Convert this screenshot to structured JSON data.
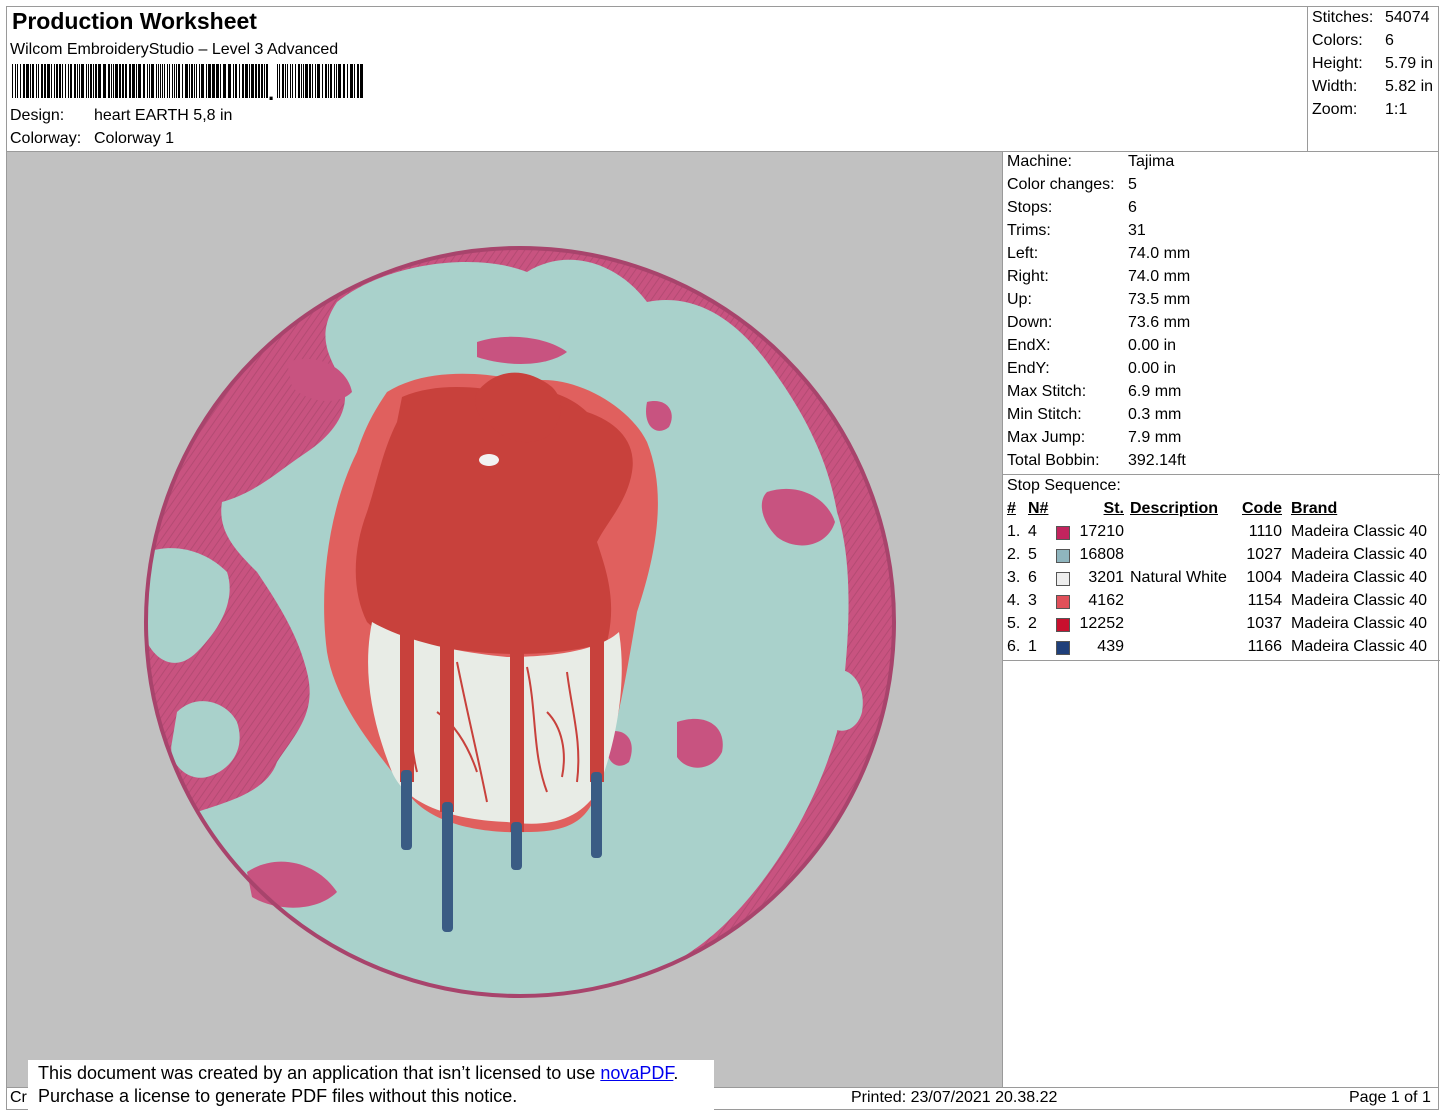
{
  "header": {
    "title": "Production Worksheet",
    "software": "Wilcom EmbroideryStudio – Level 3 Advanced",
    "design_label": "Design:",
    "design_value": "heart EARTH 5,8 in",
    "colorway_label": "Colorway:",
    "colorway_value": "Colorway 1"
  },
  "stats": [
    {
      "label": "Stitches:",
      "value": "54074"
    },
    {
      "label": "Colors:",
      "value": "6"
    },
    {
      "label": "Height:",
      "value": "5.79 in"
    },
    {
      "label": "Width:",
      "value": "5.82 in"
    },
    {
      "label": "Zoom:",
      "value": "1:1"
    }
  ],
  "machine_info": [
    {
      "label": "Machine:",
      "value": "Tajima"
    },
    {
      "label": "Color changes:",
      "value": "5"
    },
    {
      "label": "Stops:",
      "value": "6"
    },
    {
      "label": "Trims:",
      "value": "31"
    },
    {
      "label": "Left:",
      "value": "74.0 mm"
    },
    {
      "label": "Right:",
      "value": "74.0 mm"
    },
    {
      "label": "Up:",
      "value": "73.5 mm"
    },
    {
      "label": "Down:",
      "value": "73.6 mm"
    },
    {
      "label": "EndX:",
      "value": "0.00 in"
    },
    {
      "label": "EndY:",
      "value": "0.00 in"
    },
    {
      "label": "Max Stitch:",
      "value": "6.9 mm"
    },
    {
      "label": "Min Stitch:",
      "value": "0.3 mm"
    },
    {
      "label": "Max Jump:",
      "value": "7.9 mm"
    },
    {
      "label": "Total Bobbin:",
      "value": "392.14ft"
    }
  ],
  "stop_sequence": {
    "title": "Stop Sequence:",
    "headers": {
      "idx": "#",
      "n": "N#",
      "st": "St.",
      "description": "Description",
      "code": "Code",
      "brand": "Brand"
    },
    "rows": [
      {
        "idx": "1.",
        "n": "4",
        "color": "#c2245e",
        "st": "17210",
        "description": "",
        "code": "1110",
        "brand": "Madeira Classic 40"
      },
      {
        "idx": "2.",
        "n": "5",
        "color": "#8fb5be",
        "st": "16808",
        "description": "",
        "code": "1027",
        "brand": "Madeira Classic 40"
      },
      {
        "idx": "3.",
        "n": "6",
        "color": "#eeeeee",
        "st": "3201",
        "description": "Natural White",
        "code": "1004",
        "brand": "Madeira Classic 40"
      },
      {
        "idx": "4.",
        "n": "3",
        "color": "#e0505a",
        "st": "4162",
        "description": "",
        "code": "1154",
        "brand": "Madeira Classic 40"
      },
      {
        "idx": "5.",
        "n": "2",
        "color": "#c8102e",
        "st": "12252",
        "description": "",
        "code": "1037",
        "brand": "Madeira Classic 40"
      },
      {
        "idx": "6.",
        "n": "1",
        "color": "#1f3f7a",
        "st": "439",
        "description": "",
        "code": "1166",
        "brand": "Madeira Classic 40"
      }
    ]
  },
  "footer": {
    "created_prefix": "Cr",
    "printed": "Printed: 23/07/2021 20.38.22",
    "page": "Page 1 of 1"
  },
  "notice": {
    "line1_prefix": "This document was created by an application that isn’t licensed to use ",
    "link_text": "novaPDF",
    "line1_suffix": ".",
    "line2": "Purchase a license to generate PDF files without this notice."
  },
  "colors": {
    "background": "#c1c1c1",
    "pink": "#c85380",
    "teal": "#a9d1cb",
    "heart_red": "#c8413c",
    "heart_light": "#e0605e",
    "white_thread": "#e8ece6",
    "navy": "#3a5c84"
  }
}
